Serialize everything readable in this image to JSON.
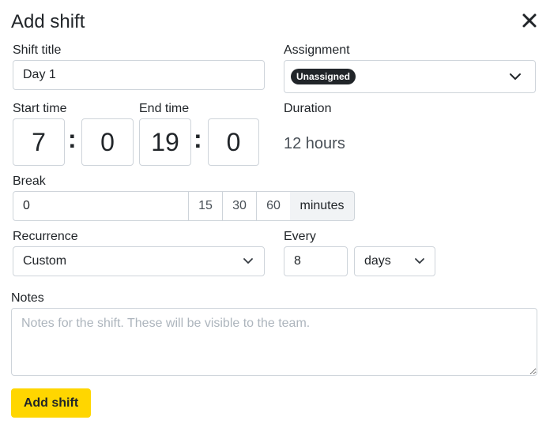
{
  "dialog": {
    "title": "Add shift",
    "close_icon": "close-icon"
  },
  "shift_title": {
    "label": "Shift title",
    "value": "Day 1"
  },
  "assignment": {
    "label": "Assignment",
    "badge": "Unassigned",
    "chevron_icon": "chevron-down-icon"
  },
  "start_time": {
    "label": "Start time",
    "hour": "7",
    "minute": "0",
    "separator": ":"
  },
  "end_time": {
    "label": "End time",
    "hour": "19",
    "minute": "0",
    "separator": ":"
  },
  "duration": {
    "label": "Duration",
    "value": "12 hours"
  },
  "break": {
    "label": "Break",
    "value": "0",
    "presets": [
      "15",
      "30",
      "60"
    ],
    "unit": "minutes"
  },
  "recurrence": {
    "label": "Recurrence",
    "selected": "Custom",
    "chevron_icon": "chevron-down-icon"
  },
  "every": {
    "label": "Every",
    "value": "8",
    "unit_selected": "days",
    "chevron_icon": "chevron-down-icon"
  },
  "notes": {
    "label": "Notes",
    "placeholder": "Notes for the shift. These will be visible to the team."
  },
  "submit": {
    "label": "Add shift"
  },
  "colors": {
    "primary_button": "#ffd600",
    "badge_bg": "#212529",
    "border": "#ced4da"
  }
}
